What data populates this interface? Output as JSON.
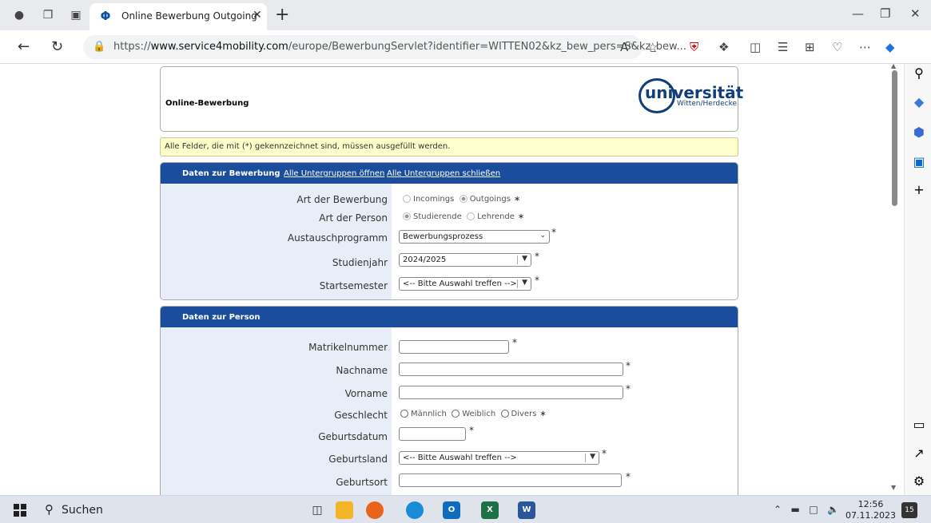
{
  "browser": {
    "tab_title": "Online Bewerbung Outgoing",
    "url_prefix": "https://",
    "url_host": "www.service4mobility.com",
    "url_rest": "/europe/BewerbungServlet?identifier=WITTEN02&kz_bew_pers=S&kz_bew..."
  },
  "header": {
    "title": "Online-Bewerbung",
    "logo_main": "universität",
    "logo_sub": "Witten/Herdecke"
  },
  "notice": "Alle Felder, die mit (*) gekennzeichnet sind, müssen ausgefüllt werden.",
  "section1": {
    "heading": "Daten zur Bewerbung",
    "open_all": "Alle Untergruppen öffnen",
    "close_all": "Alle Untergruppen schließen",
    "labels": {
      "art_bewerbung": "Art der Bewerbung",
      "art_person": "Art der Person",
      "austausch": "Austauschprogramm",
      "studienjahr": "Studienjahr",
      "startsemester": "Startsemester"
    },
    "opt_incomings": "Incomings",
    "opt_outgoings": "Outgoings",
    "opt_studierende": "Studierende",
    "opt_lehrende": "Lehrende",
    "austausch_value": "Bewerbungsprozess",
    "studienjahr_value": "2024/2025",
    "startsemester_value": "<-- Bitte Auswahl treffen -->"
  },
  "section2": {
    "heading": "Daten zur Person",
    "labels": {
      "matrikel": "Matrikelnummer",
      "nachname": "Nachname",
      "vorname": "Vorname",
      "geschlecht": "Geschlecht",
      "geburtsdatum": "Geburtsdatum",
      "geburtsland": "Geburtsland",
      "geburtsort": "Geburtsort"
    },
    "opt_maennlich": "Männlich",
    "opt_weiblich": "Weiblich",
    "opt_divers": "Divers",
    "geburtsland_value": "<-- Bitte Auswahl treffen -->"
  },
  "required_mark": "*",
  "required_small": "∗",
  "taskbar": {
    "search": "Suchen",
    "time": "12:56",
    "date": "07.11.2023",
    "notif_count": "15"
  }
}
